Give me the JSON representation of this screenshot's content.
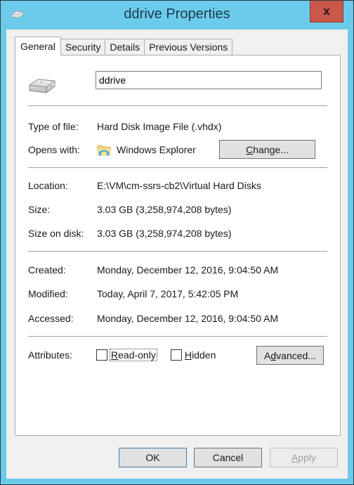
{
  "window": {
    "title": "ddrive Properties",
    "close_label": "x"
  },
  "tabs": [
    {
      "label": "General",
      "active": true
    },
    {
      "label": "Security",
      "active": false
    },
    {
      "label": "Details",
      "active": false
    },
    {
      "label": "Previous Versions",
      "active": false
    }
  ],
  "general": {
    "file_name": "ddrive",
    "type_label": "Type of file:",
    "type_value": "Hard Disk Image File (.vhdx)",
    "opens_label": "Opens with:",
    "opens_value": "Windows Explorer",
    "change_button": {
      "pre": "",
      "accel": "C",
      "post": "hange..."
    },
    "location_label": "Location:",
    "location_value": "E:\\VM\\cm-ssrs-cb2\\Virtual Hard Disks",
    "size_label": "Size:",
    "size_value": "3.03 GB (3,258,974,208 bytes)",
    "size_disk_label": "Size on disk:",
    "size_disk_value": "3.03 GB (3,258,974,208 bytes)",
    "created_label": "Created:",
    "created_value": "Monday, December 12, 2016, 9:04:50 AM",
    "modified_label": "Modified:",
    "modified_value": "Today, April 7, 2017, 5:42:05 PM",
    "accessed_label": "Accessed:",
    "accessed_value": "Monday, December 12, 2016, 9:04:50 AM",
    "attributes_label": "Attributes:",
    "readonly": {
      "accel": "R",
      "post": "ead-only",
      "checked": false
    },
    "hidden": {
      "accel": "H",
      "post": "idden",
      "checked": false
    },
    "advanced_button": {
      "pre": "A",
      "accel": "d",
      "post": "vanced..."
    }
  },
  "footer": {
    "ok": "OK",
    "cancel": "Cancel",
    "apply": {
      "accel": "A",
      "post": "pply"
    }
  },
  "icons": {
    "title": "hard-drive-icon",
    "file": "hard-drive-icon",
    "opens_with": "file-explorer-folder-icon"
  },
  "colors": {
    "frame": "#6ccbea",
    "close": "#c9584b",
    "default_button_border": "#3c7fb1"
  }
}
